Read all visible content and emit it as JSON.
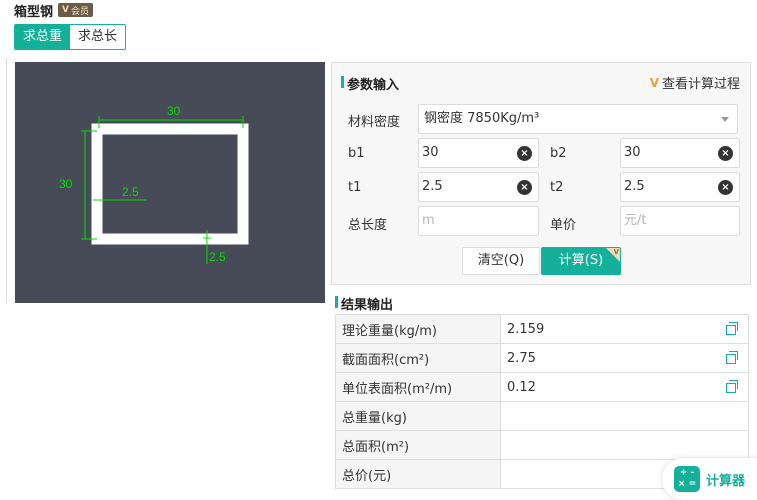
{
  "header": {
    "title": "箱型钢",
    "vip_badge_k": "V",
    "vip_badge_text": "会员"
  },
  "mode_tabs": [
    {
      "label": "求总重",
      "active": true
    },
    {
      "label": "求总长",
      "active": false
    }
  ],
  "diagram": {
    "top_width": "30",
    "left_height": "30",
    "inner_thickness": "2.5",
    "bottom_thickness": "2.5",
    "colors": {
      "background": "#474a57",
      "dimension": "#00e000",
      "section": "#ffffff"
    }
  },
  "params": {
    "title": "参数输入",
    "view_process_icon": "V",
    "view_process_label": "查看计算过程",
    "density_label": "材料密度",
    "density_value": "钢密度 7850Kg/m³",
    "b1_label": "b1",
    "b1_value": "30",
    "b2_label": "b2",
    "b2_value": "30",
    "t1_label": "t1",
    "t1_value": "2.5",
    "t2_label": "t2",
    "t2_value": "2.5",
    "length_label": "总长度",
    "length_placeholder": "m",
    "price_label": "单价",
    "price_placeholder": "元/t",
    "clear_button": "清空(Q)",
    "calc_button": "计算(S)",
    "calc_corner": "V"
  },
  "results": {
    "title": "结果输出",
    "rows": [
      {
        "label": "理论重量(kg/m)",
        "value": "2.159",
        "copyable": true
      },
      {
        "label": "截面面积(cm²)",
        "value": "2.75",
        "copyable": true
      },
      {
        "label": "单位表面积(m²/m)",
        "value": "0.12",
        "copyable": true
      },
      {
        "label": "总重量(kg)",
        "value": "",
        "copyable": false
      },
      {
        "label": "总面积(m²)",
        "value": "",
        "copyable": false
      },
      {
        "label": "总价(元)",
        "value": "",
        "copyable": false
      }
    ]
  },
  "calculator": {
    "icon_top": "+ -",
    "icon_bottom": "× =",
    "label": "计算器"
  },
  "colors": {
    "accent": "#15b09a"
  }
}
